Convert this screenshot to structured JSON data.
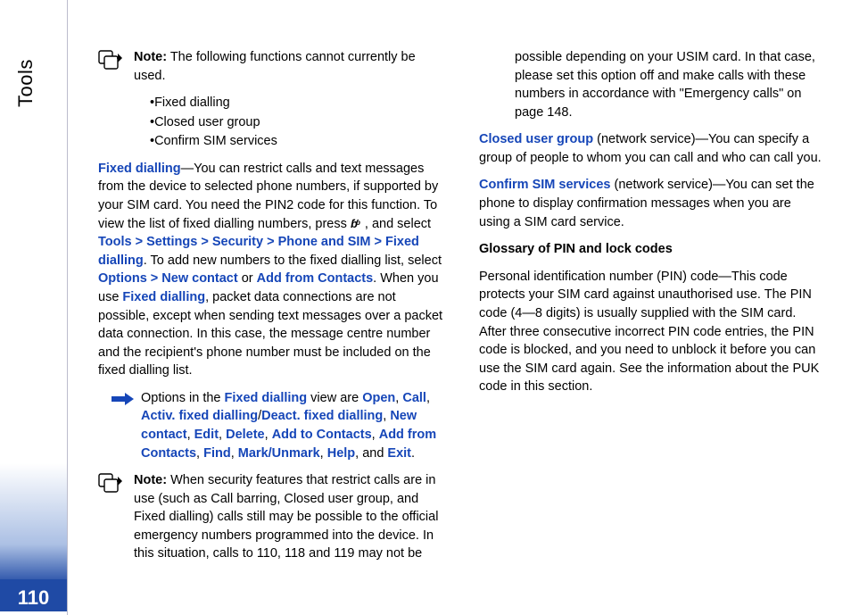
{
  "sidebar": {
    "title": "Tools"
  },
  "page_number": "110",
  "note1": {
    "label": "Note:",
    "text": " The following functions cannot currently be used.",
    "bullets": [
      "Fixed dialling",
      "Closed user group",
      "Confirm SIM services"
    ]
  },
  "fixed_dialling": {
    "term": "Fixed dialling",
    "before_icon": "—You can restrict calls and text messages from the device to selected phone numbers, if supported by your SIM card. You need the PIN2 code for this function. To view the list of fixed dialling numbers, press ",
    "after_icon": ", and select ",
    "path": "Tools > Settings > Security > Phone and SIM > Fixed dialling",
    "mid": ". To add new numbers to the fixed dialling list, select ",
    "opt1": "Options > New contact",
    "or": " or ",
    "opt2": "Add from Contacts",
    "mid2": ". When you use ",
    "again": "Fixed dialling",
    "tail": ", packet data connections are not possible, except when sending text messages over a packet data connection. In this case, the message centre number and the recipient's phone number must be included on the fixed dialling list."
  },
  "tip": {
    "lead": "Options in the ",
    "view": "Fixed dialling",
    "mid": " view are ",
    "opts": [
      "Open",
      "Call",
      "Activ. fixed dialling",
      "Deact. fixed dialling",
      "New contact",
      "Edit",
      "Delete",
      "Add to Contacts",
      "Add from Contacts",
      "Find",
      "Mark/Unmark",
      "Help",
      "Exit"
    ],
    "sep_slash": "/",
    "sep_comma": ", ",
    "and": ", and ",
    "end": "."
  },
  "note2": {
    "label": "Note:",
    "text": " When security features that restrict calls are in use (such as Call barring, Closed user group, and Fixed dialling) calls still may be possible to the official emergency numbers programmed into the device. In this situation, calls to 110, 118 and 119 may not be possible depending on your USIM card. In that case, please set this option off and make calls with these numbers in accordance with \"Emergency calls\" on page 148."
  },
  "closed_user": {
    "term": "Closed user group",
    "text": " (network service)—You can specify a group of people to whom you can call and who can call you."
  },
  "confirm_sim": {
    "term": "Confirm SIM services",
    "text": " (network service)—You can set the phone to display confirmation messages when you are using a SIM card service."
  },
  "glossary": {
    "head": "Glossary of PIN and lock codes",
    "pin": "Personal identification number (PIN) code—This code protects your SIM card against unauthorised use. The PIN code (4—8 digits) is usually supplied with the SIM card. After three consecutive incorrect PIN code entries, the PIN code is blocked, and you need to unblock it before you can use the SIM card again. See the information about the PUK code in this section."
  }
}
